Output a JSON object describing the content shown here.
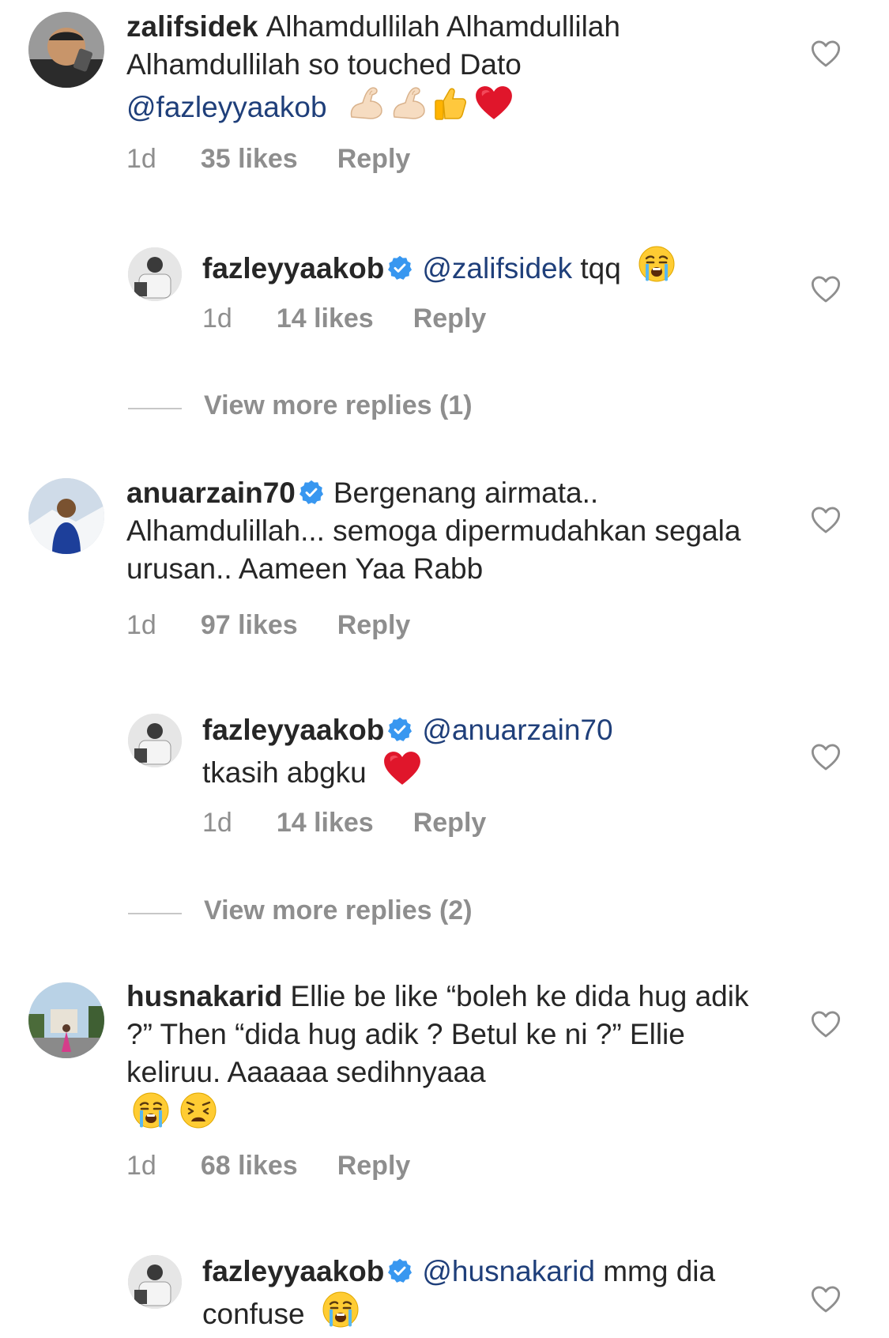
{
  "comments": [
    {
      "username": "zalifsidek",
      "text": "Alhamdullilah Alhamdullilah Alhamdullilah so touched Dato",
      "mention": "@fazleyyaakob",
      "emojis": [
        "flexed-biceps",
        "flexed-biceps",
        "thumbs-up",
        "red-heart"
      ],
      "time": "1d",
      "likes": "35 likes",
      "reply": "Reply",
      "reply_item": {
        "username": "fazleyyaakob",
        "verified": true,
        "mention": "@zalifsidek",
        "text": "tqq",
        "emojis": [
          "crying-face"
        ],
        "time": "1d",
        "likes": "14 likes",
        "reply": "Reply"
      },
      "view_more": "View more replies (1)"
    },
    {
      "username": "anuarzain70",
      "verified": true,
      "text": "Bergenang airmata.. Alhamdulillah... semoga dipermudahkan segala urusan.. Aameen Yaa Rabb",
      "time": "1d",
      "likes": "97 likes",
      "reply": "Reply",
      "reply_item": {
        "username": "fazleyyaakob",
        "verified": true,
        "mention": "@anuarzain70",
        "text": "tkasih abgku",
        "emojis": [
          "red-heart"
        ],
        "time": "1d",
        "likes": "14 likes",
        "reply": "Reply"
      },
      "view_more": "View more replies (2)"
    },
    {
      "username": "husnakarid",
      "text": "Ellie be like “boleh ke dida hug adik ?” Then “dida hug adik ? Betul ke ni ?” Ellie keliruu. Aaaaaa sedihnyaaa",
      "emojis": [
        "crying-face",
        "weary-face"
      ],
      "time": "1d",
      "likes": "68 likes",
      "reply": "Reply",
      "reply_item": {
        "username": "fazleyyaakob",
        "verified": true,
        "mention": "@husnakarid",
        "text": "mmg dia confuse",
        "emojis": [
          "crying-face"
        ]
      }
    }
  ],
  "colors": {
    "text": "#262626",
    "secondary": "#8e8e8e",
    "mention": "#1f3f7a",
    "verified": "#3897f0",
    "heart_outline": "#8e8e8e"
  }
}
